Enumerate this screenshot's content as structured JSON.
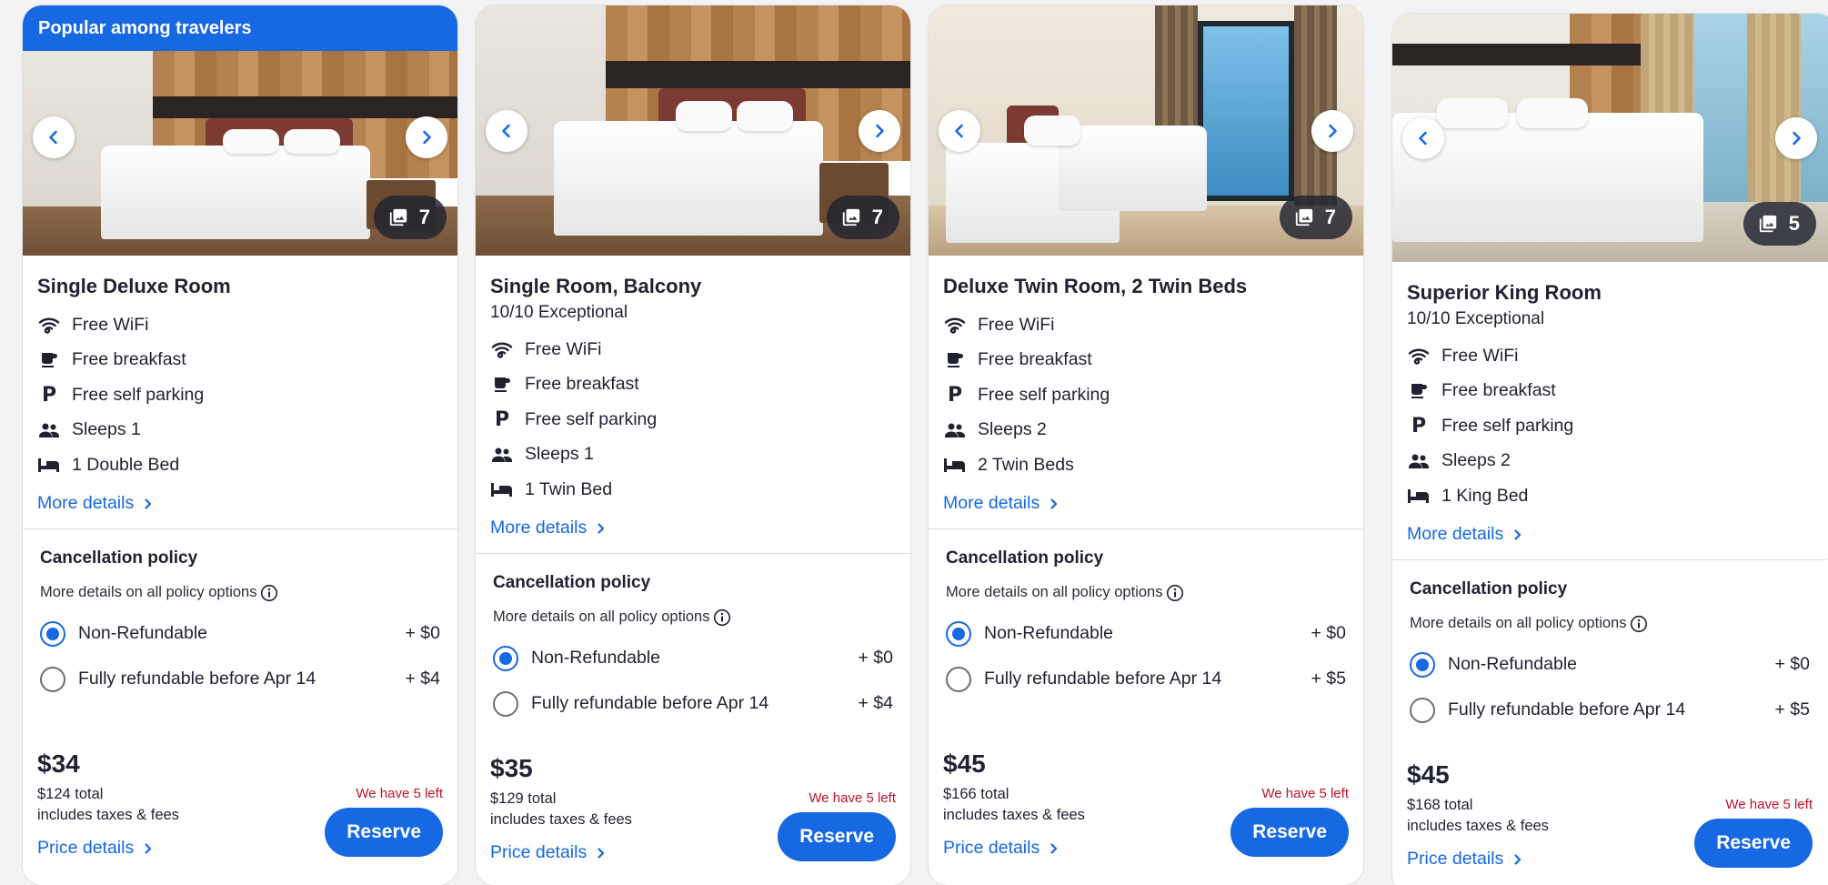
{
  "badge": "Popular among travelers",
  "rooms": [
    {
      "name": "Single Deluxe Room",
      "rating": "",
      "photo_count": "7",
      "amenities": [
        "Free WiFi",
        "Free breakfast",
        "Free self parking",
        "Sleeps 1",
        "1 Double Bed"
      ],
      "more_details": "More details",
      "policy_title": "Cancellation policy",
      "policy_sub": "More details on all policy options",
      "options": [
        {
          "label": "Non-Refundable",
          "price": "+ $0",
          "selected": true
        },
        {
          "label": "Fully refundable before Apr 14",
          "price": "+ $4",
          "selected": false
        }
      ],
      "price": "$34",
      "total": "$124 total",
      "taxes": "includes taxes & fees",
      "left_note": "We have 5 left",
      "price_details": "Price details",
      "reserve": "Reserve"
    },
    {
      "name": "Single Room, Balcony",
      "rating": "10/10 Exceptional",
      "photo_count": "7",
      "amenities": [
        "Free WiFi",
        "Free breakfast",
        "Free self parking",
        "Sleeps 1",
        "1 Twin Bed"
      ],
      "more_details": "More details",
      "policy_title": "Cancellation policy",
      "policy_sub": "More details on all policy options",
      "options": [
        {
          "label": "Non-Refundable",
          "price": "+ $0",
          "selected": true
        },
        {
          "label": "Fully refundable before Apr 14",
          "price": "+ $4",
          "selected": false
        }
      ],
      "price": "$35",
      "total": "$129 total",
      "taxes": "includes taxes & fees",
      "left_note": "We have 5 left",
      "price_details": "Price details",
      "reserve": "Reserve"
    },
    {
      "name": "Deluxe Twin Room, 2 Twin Beds",
      "rating": "",
      "photo_count": "7",
      "amenities": [
        "Free WiFi",
        "Free breakfast",
        "Free self parking",
        "Sleeps 2",
        "2 Twin Beds"
      ],
      "more_details": "More details",
      "policy_title": "Cancellation policy",
      "policy_sub": "More details on all policy options",
      "options": [
        {
          "label": "Non-Refundable",
          "price": "+ $0",
          "selected": true
        },
        {
          "label": "Fully refundable before Apr 14",
          "price": "+ $5",
          "selected": false
        }
      ],
      "price": "$45",
      "total": "$166 total",
      "taxes": "includes taxes & fees",
      "left_note": "We have 5 left",
      "price_details": "Price details",
      "reserve": "Reserve"
    },
    {
      "name": "Superior King Room",
      "rating": "10/10 Exceptional",
      "photo_count": "5",
      "amenities": [
        "Free WiFi",
        "Free breakfast",
        "Free self parking",
        "Sleeps 2",
        "1 King Bed"
      ],
      "more_details": "More details",
      "policy_title": "Cancellation policy",
      "policy_sub": "More details on all policy options",
      "options": [
        {
          "label": "Non-Refundable",
          "price": "+ $0",
          "selected": true
        },
        {
          "label": "Fully refundable before Apr 14",
          "price": "+ $5",
          "selected": false
        }
      ],
      "price": "$45",
      "total": "$168 total",
      "taxes": "includes taxes & fees",
      "left_note": "We have 5 left",
      "price_details": "Price details",
      "reserve": "Reserve"
    }
  ],
  "icons": {
    "amenities": [
      "wifi-icon",
      "coffee-cup-icon",
      "parking-icon",
      "people-icon",
      "bed-icon"
    ],
    "photo": "image-gallery-icon",
    "prev": "chevron-left-icon",
    "next": "chevron-right-icon",
    "info": "info-icon"
  },
  "colors": {
    "accent": "#1668e3",
    "alert": "#c3102d",
    "text": "#1f2230"
  }
}
